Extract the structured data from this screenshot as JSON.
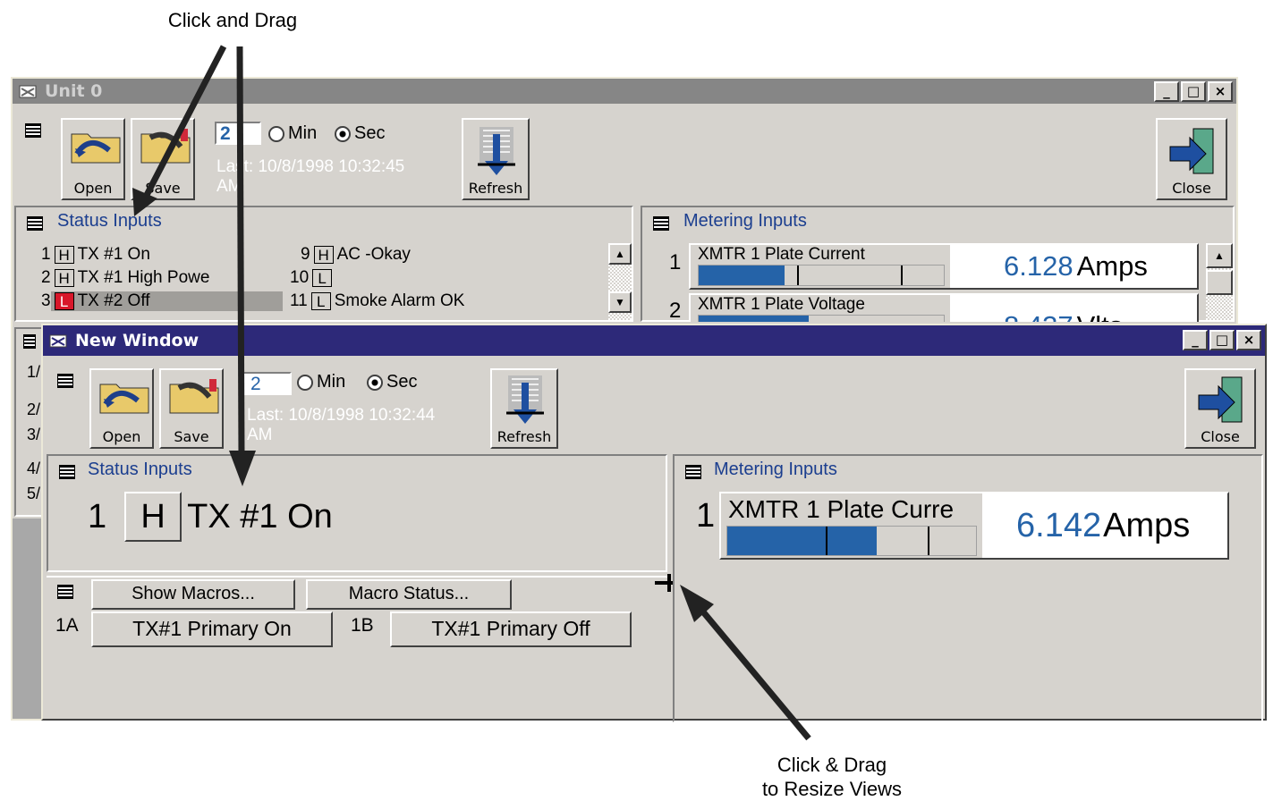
{
  "annotations": {
    "top": "Click and Drag",
    "bottom_line1": "Click & Drag",
    "bottom_line2": "to Resize Views"
  },
  "back_window": {
    "title": "Unit 0",
    "toolbar": {
      "open": "Open",
      "save": "Save",
      "refresh": "Refresh",
      "close": "Close",
      "interval_value": "2",
      "min_label": "Min",
      "sec_label": "Sec",
      "last_update": "Last: 10/8/1998 10:32:45",
      "last_update_am": "AM"
    },
    "status_title": "Status Inputs",
    "status_rows": [
      {
        "num": "1",
        "state": "H",
        "label": "TX #1 On"
      },
      {
        "num": "2",
        "state": "H",
        "label": "TX #1 High Powe"
      },
      {
        "num": "3",
        "state": "L",
        "label": "TX #2  Off"
      },
      {
        "num": "9",
        "state": "H",
        "label": "AC -Okay"
      },
      {
        "num": "10",
        "state": "L",
        "label": ""
      },
      {
        "num": "11",
        "state": "L",
        "label": "Smoke Alarm OK"
      }
    ],
    "metering_title": "Metering Inputs",
    "meters": [
      {
        "num": "1",
        "name": "XMTR 1 Plate Current",
        "value": "6.128",
        "unit": "Amps",
        "fill": 0.35
      },
      {
        "num": "2",
        "name": "XMTR 1 Plate Voltage",
        "value": "8.437",
        "unit": "Vlts",
        "fill": 0.45
      }
    ],
    "side_rows": [
      "1/",
      "2/",
      "3/",
      "4/",
      "5/"
    ]
  },
  "front_window": {
    "title": "New Window",
    "toolbar": {
      "open": "Open",
      "save": "Save",
      "refresh": "Refresh",
      "close": "Close",
      "interval_value": "2",
      "min_label": "Min",
      "sec_label": "Sec",
      "last_update": "Last: 10/8/1998 10:32:44",
      "last_update_am": "AM"
    },
    "status_title": "Status Inputs",
    "status_row": {
      "num": "1",
      "state": "H",
      "label": "TX #1 On"
    },
    "metering_title": "Metering Inputs",
    "meter": {
      "num": "1",
      "name": "XMTR 1 Plate Curre",
      "value": "6.142",
      "unit": "Amps",
      "fill": 0.6
    },
    "macros": {
      "show_btn": "Show Macros...",
      "status_btn": "Macro Status...",
      "items": [
        {
          "id": "1A",
          "label": "TX#1 Primary On"
        },
        {
          "id": "1B",
          "label": "TX#1 Primary Off"
        }
      ]
    }
  },
  "colors": {
    "accent_blue": "#2563a8",
    "title_active": "#2d2979",
    "state_low_red": "#d8172a"
  }
}
